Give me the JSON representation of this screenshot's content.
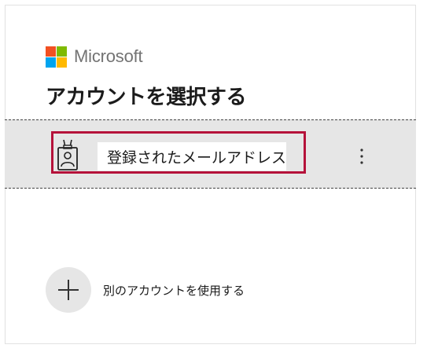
{
  "brand": {
    "name": "Microsoft",
    "logo_colors": [
      "#f25022",
      "#7fba00",
      "#00a4ef",
      "#ffb900"
    ]
  },
  "title": "アカウントを選択する",
  "account": {
    "icon": "badge-icon",
    "email_label": "登録されたメールアドレス",
    "menu_icon": "more-vertical-icon",
    "highlight_color": "#b5123a"
  },
  "add_account": {
    "icon": "plus-icon",
    "label": "別のアカウントを使用する"
  }
}
